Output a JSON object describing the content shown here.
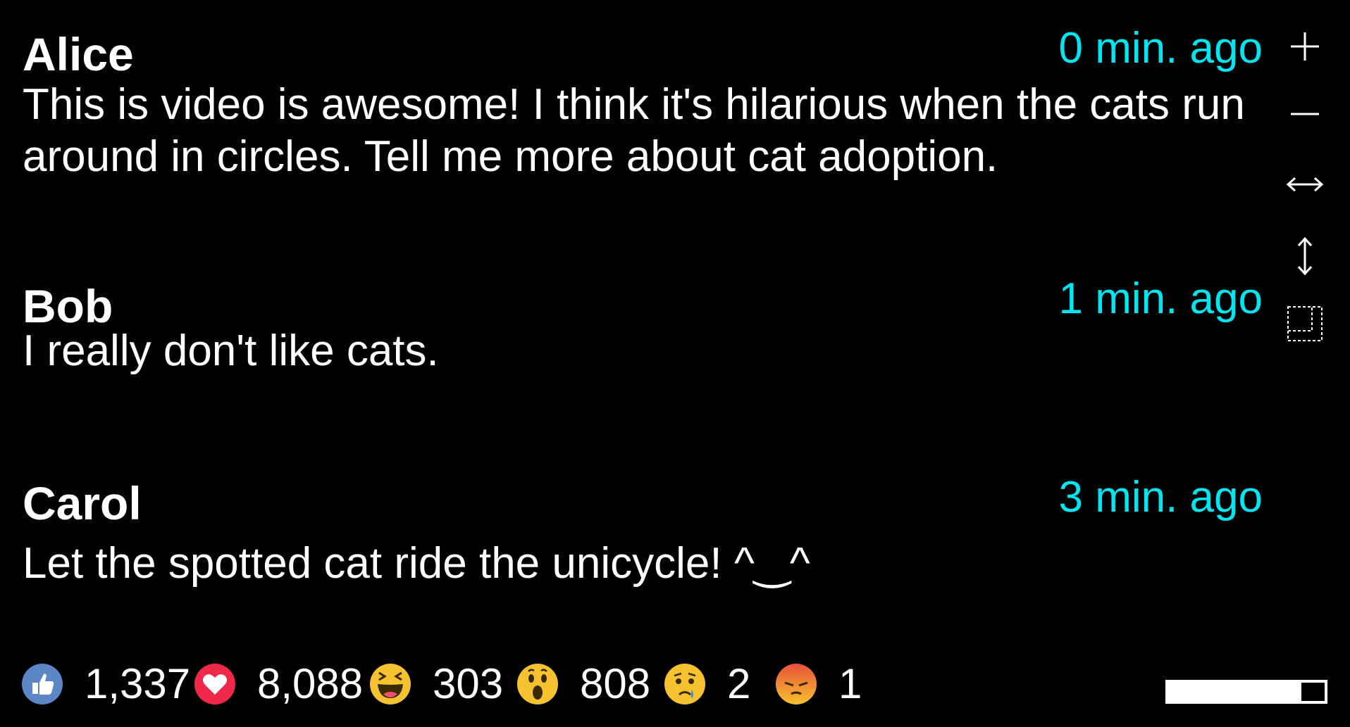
{
  "colors": {
    "background": "#000000",
    "text": "#ffffff",
    "timestamp": "#00e5f0"
  },
  "comments": [
    {
      "author": "Alice",
      "time": "0 min. ago",
      "text": "This is video is awesome! I think it's hilarious when the cats run around in circles. Tell me more about cat adoption."
    },
    {
      "author": "Bob",
      "time": "1 min. ago",
      "text": "I really don't like cats."
    },
    {
      "author": "Carol",
      "time": "3 min. ago",
      "text": "Let the spotted cat ride the unicycle! ^‿^"
    }
  ],
  "toolbar": {
    "icons": [
      "plus-icon",
      "minus-icon",
      "horizontal-resize-icon",
      "vertical-resize-icon",
      "select-region-icon"
    ]
  },
  "reactions": [
    {
      "icon": "like-icon",
      "count": "1,337"
    },
    {
      "icon": "love-icon",
      "count": "8,088"
    },
    {
      "icon": "haha-icon",
      "count": "303"
    },
    {
      "icon": "wow-icon",
      "count": "808"
    },
    {
      "icon": "sad-icon",
      "count": "2"
    },
    {
      "icon": "angry-icon",
      "count": "1"
    }
  ],
  "progress": {
    "fraction": 0.82
  }
}
